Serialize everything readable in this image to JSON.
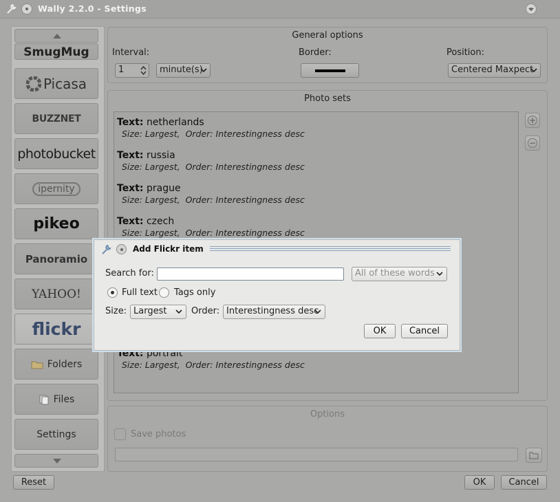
{
  "window": {
    "title": "Wally 2.2.0 - Settings"
  },
  "sidebar": {
    "items": [
      {
        "label": "SmugMug"
      },
      {
        "label": "Picasa"
      },
      {
        "label": "BUZZNET"
      },
      {
        "label": "photobucket"
      },
      {
        "label": "ipernity"
      },
      {
        "label": "pikeo"
      },
      {
        "label": "Panoramio"
      },
      {
        "label": "YAHOO!"
      },
      {
        "label": "flickr"
      },
      {
        "label": "Folders"
      },
      {
        "label": "Files"
      },
      {
        "label": "Settings"
      }
    ]
  },
  "general": {
    "title": "General options",
    "interval_label": "Interval:",
    "interval_value": "1",
    "interval_unit": "minute(s)",
    "border_label": "Border:",
    "position_label": "Position:",
    "position_value": "Centered Maxpect"
  },
  "photosets": {
    "title": "Photo sets",
    "text_key": "Text:",
    "items": [
      {
        "text": "netherlands",
        "size": "Size: Largest,",
        "order": "Order: Interestingness desc"
      },
      {
        "text": "russia",
        "size": "Size: Largest,",
        "order": "Order: Interestingness desc"
      },
      {
        "text": "prague",
        "size": "Size: Largest,",
        "order": "Order: Interestingness desc"
      },
      {
        "text": "czech",
        "size": "Size: Largest,",
        "order": "Order: Interestingness desc"
      },
      {
        "text": "portrait",
        "size": "Size: Largest,",
        "order": "Order: Interestingness desc"
      }
    ]
  },
  "options": {
    "title": "Options",
    "save_photos": "Save photos"
  },
  "footer": {
    "reset": "Reset",
    "ok": "OK",
    "cancel": "Cancel"
  },
  "dialog": {
    "title": "Add Flickr item",
    "search_label": "Search for:",
    "search_value": "",
    "match_mode": "All of these words",
    "full_text": "Full text",
    "tags_only": "Tags only",
    "size_label": "Size:",
    "size_value": "Largest",
    "order_label": "Order:",
    "order_value": "Interestingness desc",
    "ok": "OK",
    "cancel": "Cancel"
  }
}
